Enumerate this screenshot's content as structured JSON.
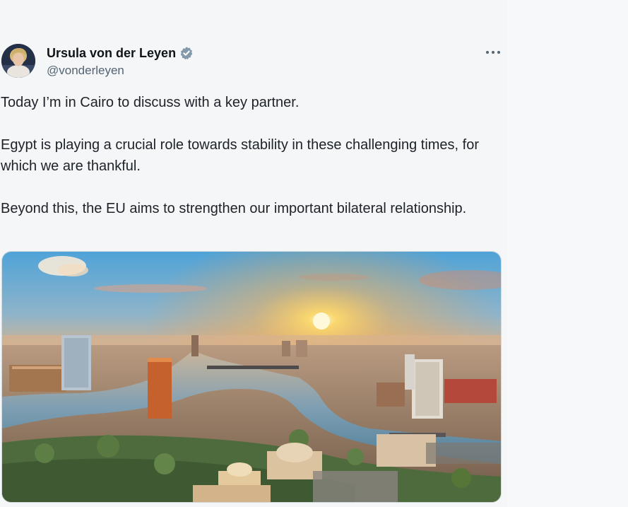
{
  "author": {
    "display_name": "Ursula von der Leyen",
    "handle": "@vonderleyen",
    "verified": true,
    "avatar_icon": "profile-photo"
  },
  "more_icon": "more-horizontal-icon",
  "tweet": {
    "paragraphs": [
      "Today I’m in Cairo to discuss with a key partner.",
      "Egypt is playing a crucial role towards stability in these challenging times, for which we are thankful.",
      "Beyond this, the EU aims to strengthen our important bilateral relationship."
    ]
  },
  "colors": {
    "verified_badge": "#829aab",
    "handle": "#536471",
    "text": "#1d2228"
  }
}
